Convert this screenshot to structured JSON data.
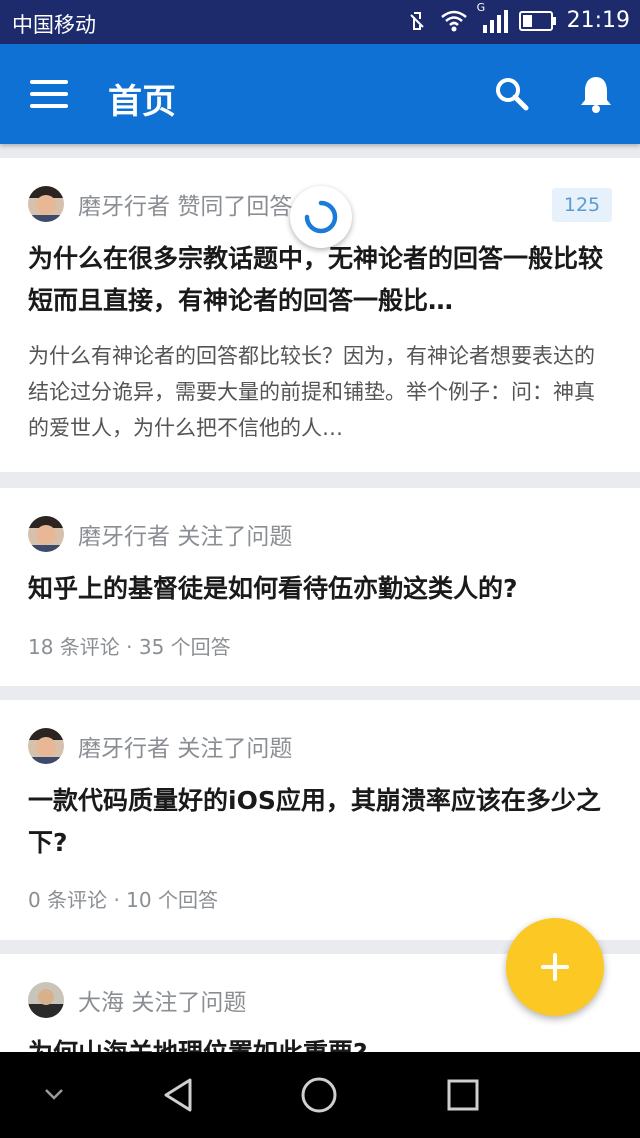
{
  "status_bar": {
    "carrier": "中国移动",
    "time": "21:19",
    "network": "G"
  },
  "app_bar": {
    "title": "首页"
  },
  "colors": {
    "app_bar": "#0f71d4",
    "status_bar": "#1d2a6b",
    "fab": "#fcc824",
    "vote_badge_bg": "#e6f1fb",
    "vote_badge_text": "#5a9bd5"
  },
  "feed": [
    {
      "user": "磨牙行者",
      "action": "赞同了回答",
      "votes": "125",
      "title": "为什么在很多宗教话题中，无神论者的回答一般比较短而且直接，有神论者的回答一般比…",
      "excerpt": "为什么有神论者的回答都比较长？因为，有神论者想要表达的结论过分诡异，需要大量的前提和铺垫。举个例子：问：神真的爱世人，为什么把不信他的人…"
    },
    {
      "user": "磨牙行者",
      "action": "关注了问题",
      "title": "知乎上的基督徒是如何看待伍亦勤这类人的?",
      "meta": "18 条评论 · 35 个回答"
    },
    {
      "user": "磨牙行者",
      "action": "关注了问题",
      "title": "一款代码质量好的iOS应用，其崩溃率应该在多少之下?",
      "meta": "0 条评论 · 10 个回答"
    },
    {
      "user": "大海",
      "action": "关注了问题",
      "title": "为何山海关地理位置如此重要?"
    }
  ],
  "icons": {
    "menu": "menu-icon",
    "search": "search-icon",
    "notifications": "bell-icon",
    "fab": "plus-icon",
    "nav_collapse": "chevron-down-icon",
    "nav_back": "back-triangle-icon",
    "nav_home": "home-circle-icon",
    "nav_recents": "recents-square-icon"
  }
}
